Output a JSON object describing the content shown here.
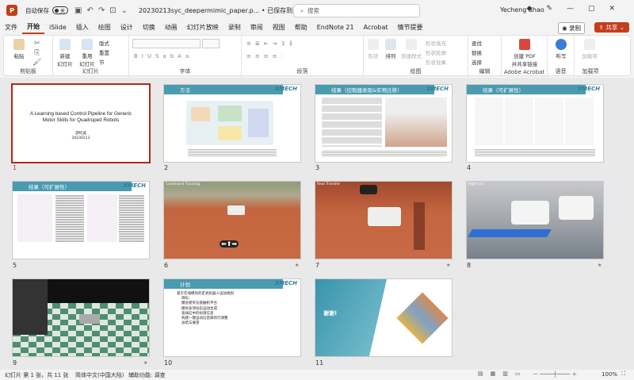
{
  "titlebar": {
    "autosave_label": "自动保存",
    "autosave_state": "关",
    "doc_title": "20230213syc_deepermimic_paper.p... • 已保存到此电脑 ⌄",
    "search_placeholder": "搜索",
    "user_name": "Yecheng Shao"
  },
  "tabs": [
    "文件",
    "开始",
    "iSlide",
    "插入",
    "绘图",
    "设计",
    "切换",
    "动画",
    "幻灯片放映",
    "录制",
    "审阅",
    "视图",
    "帮助",
    "EndNote 21",
    "Acrobat",
    "情节提要"
  ],
  "record_label": "◉ 录制",
  "share_label": "⇪ 共享 ⌄",
  "ribbon": {
    "clipboard": {
      "paste": "粘贴",
      "label": "剪贴板"
    },
    "slides": {
      "new_slide": "新建\n幻灯片",
      "reuse": "重用\n幻灯片",
      "layout": "版式",
      "reset": "重置",
      "section": "节",
      "label": "幻灯片"
    },
    "font": {
      "label": "字体"
    },
    "paragraph": {
      "label": "段落"
    },
    "drawing": {
      "shape": "形状",
      "arrange": "排列",
      "quick_styles": "快速样式",
      "fill": "形状填充",
      "outline": "形状轮廓",
      "effect": "形状效果",
      "label": "绘图"
    },
    "editing": {
      "find": "查找",
      "replace": "替换",
      "select": "选择",
      "label": "编辑"
    },
    "acrobat": {
      "create_pdf": "创建 PDF\n并共享链接",
      "label": "Adobe Acrobat"
    },
    "voice": {
      "dictate": "听写",
      "label": "语音"
    },
    "addins": {
      "addins": "加载项",
      "label": "加载项"
    }
  },
  "slides": [
    {
      "n": "1",
      "title": "A Learning based Control Pipeline for Generic Motor Skills for Quadruped Robots",
      "author": "邵屹诚",
      "date": "20230213"
    },
    {
      "n": "2",
      "header": "方法"
    },
    {
      "n": "3",
      "header": "结果（控制器表现&实物迁移）"
    },
    {
      "n": "4",
      "header": "结果（可扩展性）"
    },
    {
      "n": "5",
      "header": "结果（可扩展性）"
    },
    {
      "n": "6",
      "video_label": "Command Tracking"
    },
    {
      "n": "7",
      "video_label": "Real Transfer"
    },
    {
      "n": "8",
      "video_label": "High Jun"
    },
    {
      "n": "9",
      "video_label": "Terrain Curr"
    },
    {
      "n": "10",
      "header": "计划",
      "bullets": [
        "基于在线模仿的定式机器人运动规划",
        "目标：",
        "模仿者奖与接触机平台",
        "模仿多项动态运动生成",
        "宽阔应中的扮演信息",
        "构建一键运动信息库的行调整",
        "总结与展望"
      ]
    },
    {
      "n": "11",
      "center_text": "谢谢!"
    }
  ],
  "logo_text": "XMECH",
  "statusbar": {
    "slide_info": "幻灯片 第 1 张，共 11 张",
    "language": "简体中文(中国大陆)",
    "accessibility": "辅助功能: 调查",
    "zoom": "100%"
  }
}
